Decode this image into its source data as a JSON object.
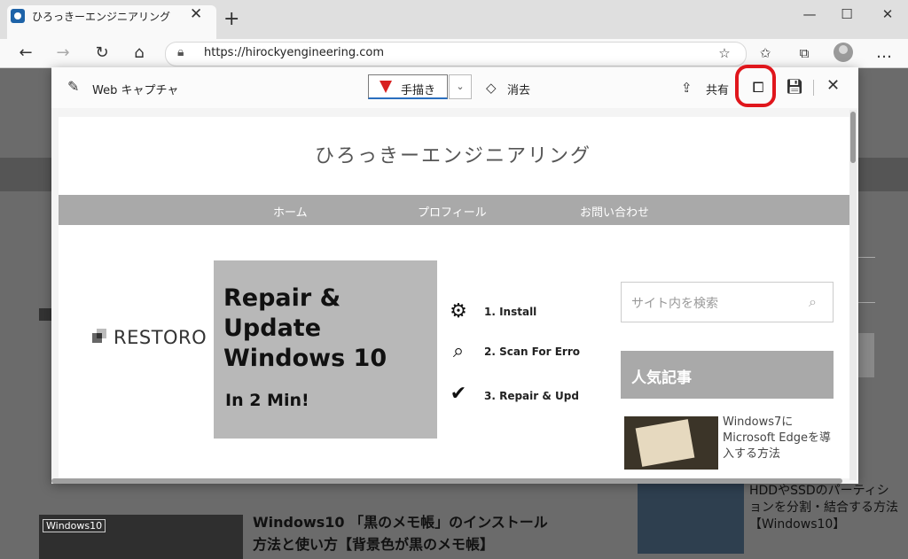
{
  "browser": {
    "tab_title": "ひろっきーエンジニアリング",
    "url": "https://hirockyengineering.com"
  },
  "capture": {
    "title": "Web キャプチャ",
    "draw_label": "手描き",
    "erase_label": "消去",
    "share_label": "共有",
    "accent_color": "#e0161c"
  },
  "site": {
    "title": "ひろっきーエンジニアリング",
    "nav": [
      "ホーム",
      "プロフィール",
      "お問い合わせ"
    ],
    "ad": {
      "brand": "RESTORO",
      "headline": "Repair & Update Windows 10",
      "sub": "In 2 Min!",
      "steps": [
        "1. Install",
        "2. Scan For Erro",
        "3. Repair & Upd"
      ]
    },
    "search_placeholder": "サイト内を検索",
    "popular_heading": "人気記事",
    "popular_item": "Windows7にMicrosoft Edgeを導入する方法"
  },
  "background_page": {
    "article_tag": "Windows10",
    "article_title_1": "Windows10 「黒のメモ帳」のインストール",
    "article_title_2": "方法と使い方【背景色が黒のメモ帳】",
    "side_article": "HDDやSSDのパーティションを分割・結合する方法【Windows10】"
  }
}
